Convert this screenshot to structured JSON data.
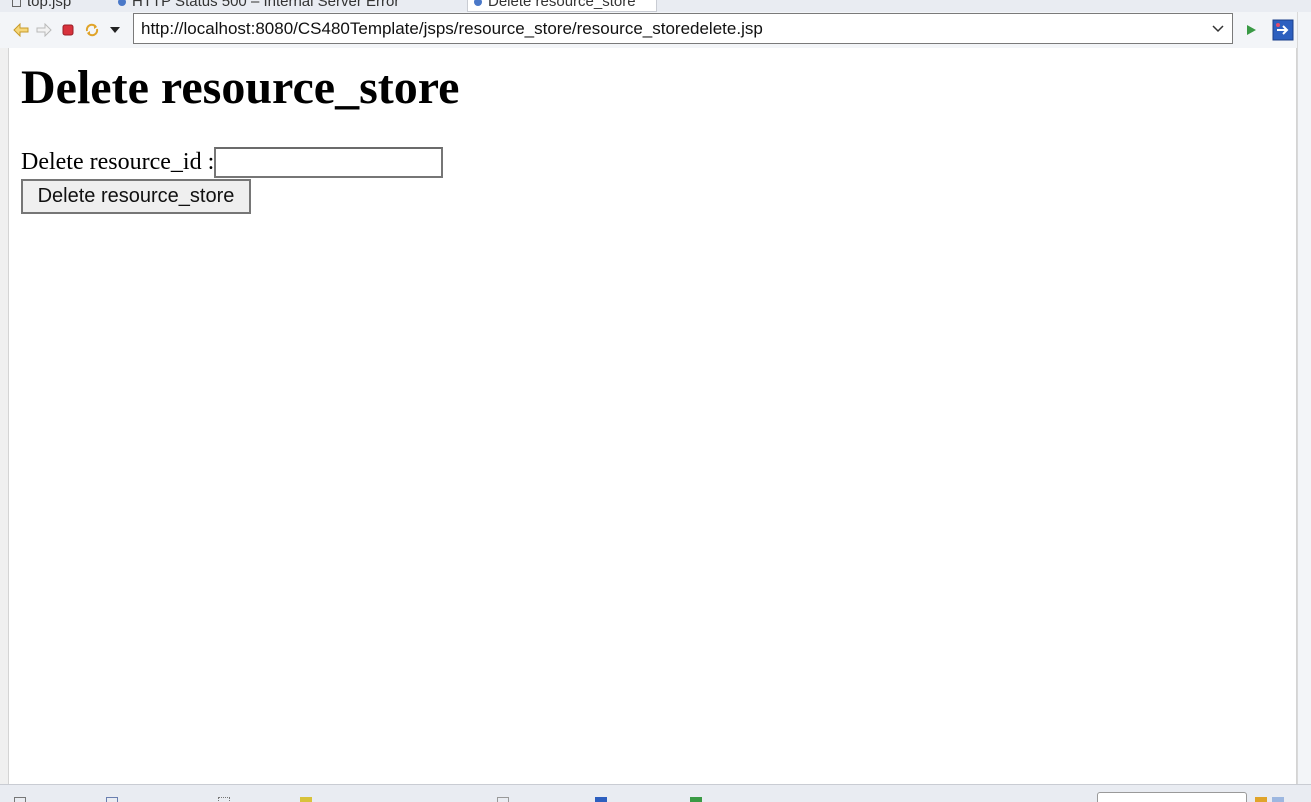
{
  "tabs": [
    {
      "label": "top.jsp",
      "icon": "jsp-file-icon"
    },
    {
      "label": "HTTP Status 500 – Internal Server Error",
      "icon": "globe-icon"
    },
    {
      "label": "Delete resource_store",
      "icon": "globe-icon",
      "active": true
    }
  ],
  "toolbar": {
    "back_icon": "back-arrow-icon",
    "forward_icon": "forward-arrow-icon",
    "stop_icon": "stop-icon",
    "refresh_icon": "refresh-icon",
    "menu_icon": "dropdown-menu-icon",
    "url": "http://localhost:8080/CS480Template/jsps/resource_store/resource_storedelete.jsp",
    "go_icon": "go-run-icon",
    "open_external_icon": "external-browser-icon"
  },
  "page": {
    "heading": "Delete resource_store",
    "field_label": "Delete resource_id :",
    "field_value": "",
    "submit_label": "Delete resource_store"
  },
  "colors": {
    "back_forward": "#e3b23c",
    "stop": "#d8323c",
    "go": "#3a9a45",
    "external": "#2d5fbf"
  }
}
